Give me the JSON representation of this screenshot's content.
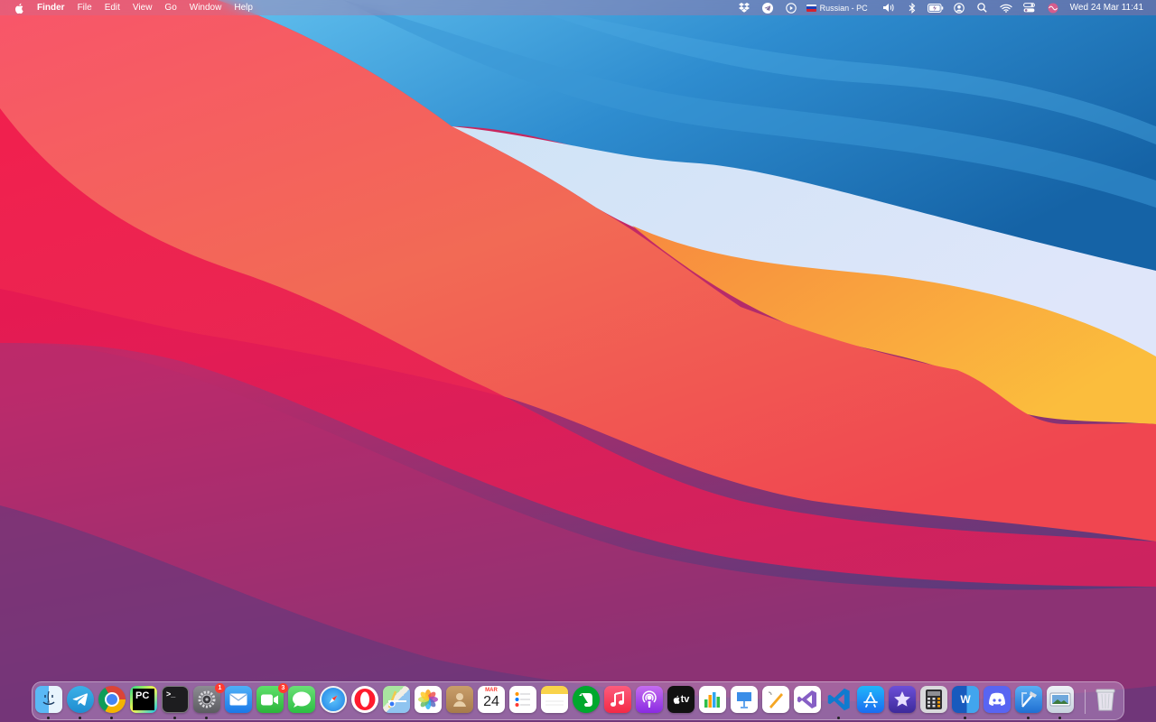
{
  "menubar": {
    "app_name": "Finder",
    "menus": [
      "File",
      "Edit",
      "View",
      "Go",
      "Window",
      "Help"
    ],
    "input_source": "Russian - PC",
    "clock": "Wed 24 Mar  11:41"
  },
  "dock": {
    "apps": [
      {
        "name": "Finder",
        "running": true
      },
      {
        "name": "Telegram",
        "running": true
      },
      {
        "name": "Google Chrome",
        "running": true
      },
      {
        "name": "PyCharm",
        "label": "PC",
        "running": false
      },
      {
        "name": "Terminal",
        "label": ">_",
        "running": true
      },
      {
        "name": "System Preferences",
        "badge": "1",
        "running": true
      },
      {
        "name": "Mail",
        "running": false
      },
      {
        "name": "FaceTime",
        "badge": "3",
        "running": false
      },
      {
        "name": "Messages",
        "running": false
      },
      {
        "name": "Safari",
        "running": false
      },
      {
        "name": "Opera",
        "running": false
      },
      {
        "name": "Maps",
        "running": false
      },
      {
        "name": "Photos",
        "running": false
      },
      {
        "name": "Contacts",
        "running": false
      },
      {
        "name": "Calendar",
        "month": "MAR",
        "day": "24",
        "running": false
      },
      {
        "name": "Reminders",
        "running": false
      },
      {
        "name": "Notes",
        "running": false
      },
      {
        "name": "Evernote",
        "running": false
      },
      {
        "name": "Music",
        "running": false
      },
      {
        "name": "Podcasts",
        "running": false
      },
      {
        "name": "TV",
        "label": "tv",
        "running": false
      },
      {
        "name": "Numbers",
        "running": false
      },
      {
        "name": "Keynote",
        "running": false
      },
      {
        "name": "Pages",
        "running": false
      },
      {
        "name": "Visual Studio",
        "running": false
      },
      {
        "name": "Visual Studio Code",
        "running": true
      },
      {
        "name": "App Store",
        "running": false
      },
      {
        "name": "iMovie",
        "running": false
      },
      {
        "name": "Calculator",
        "running": false
      },
      {
        "name": "Microsoft Word",
        "label": "W",
        "running": true
      },
      {
        "name": "Discord",
        "running": false
      },
      {
        "name": "Xcode",
        "running": true
      },
      {
        "name": "Preview",
        "running": true
      }
    ],
    "trash": {
      "name": "Trash"
    }
  },
  "colors": {
    "sky_blue": "#2f8ed2",
    "coral": "#f26455",
    "pink_red": "#f0184a",
    "magenta": "#b02a6e",
    "orange": "#f7a13d",
    "badge_red": "#ff3b30"
  }
}
